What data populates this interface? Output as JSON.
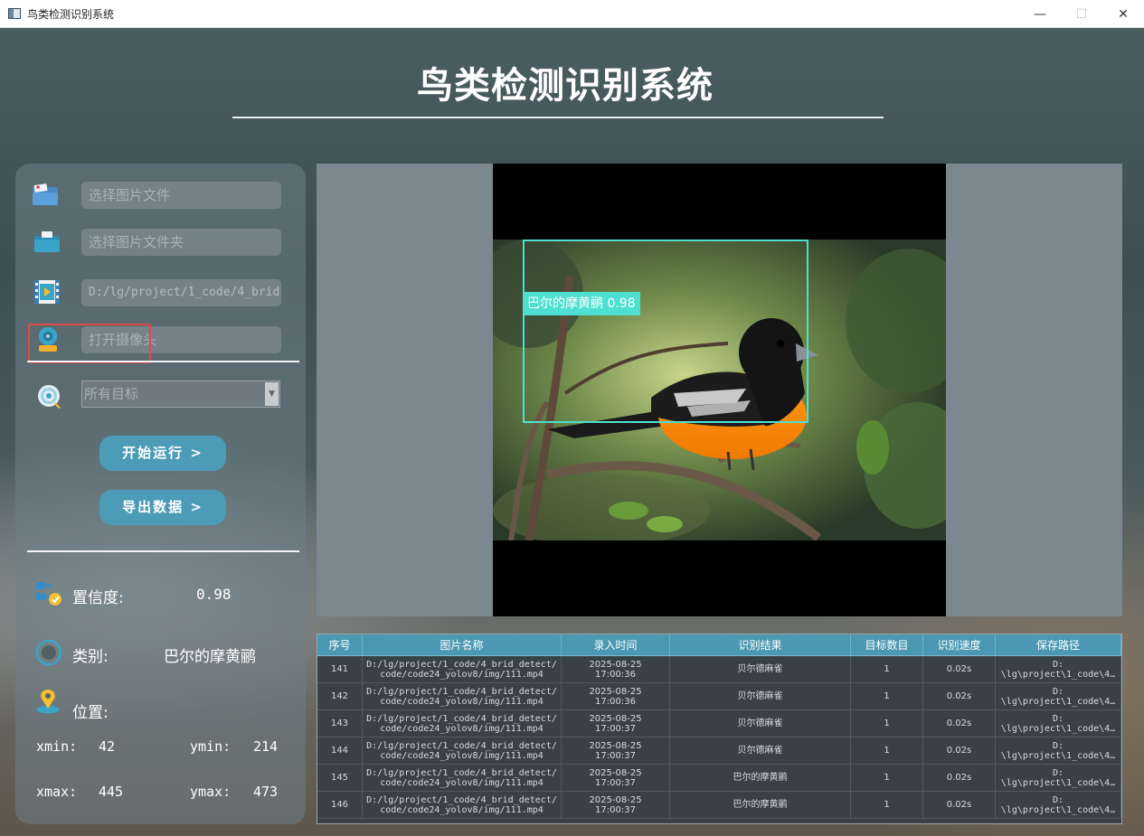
{
  "window": {
    "title": "鸟类检测识别系统",
    "min": "—",
    "max": "☐",
    "close": "✕"
  },
  "header": {
    "title": "鸟类检测识别系统"
  },
  "inputs": {
    "image_file": "选择图片文件",
    "image_folder": "选择图片文件夹",
    "video_path": "D:/lg/project/1_code/4_brid",
    "camera": "打开摄像头"
  },
  "target_select": {
    "value": "所有目标"
  },
  "buttons": {
    "start": "开始运行 >",
    "export": "导出数据 >"
  },
  "info": {
    "confidence_label": "置信度:",
    "confidence_value": "0.98",
    "class_label": "类别:",
    "class_value": "巴尔的摩黄鹂",
    "position_label": "位置:",
    "xmin_label": "xmin:",
    "xmin": "42",
    "ymin_label": "ymin:",
    "ymin": "214",
    "xmax_label": "xmax:",
    "xmax": "445",
    "ymax_label": "ymax:",
    "ymax": "473"
  },
  "detection": {
    "label": "巴尔的摩黄鹂 0.98",
    "box_color": "#4de0d0"
  },
  "table": {
    "headers": [
      "序号",
      "图片名称",
      "录入时间",
      "识别结果",
      "目标数目",
      "识别速度",
      "保存路径"
    ],
    "rows": [
      [
        "141",
        "D:/lg/project/1_code/4_brid_detect/\ncode/code24_yolov8/img/111.mp4",
        "2025-08-25\n17:00:36",
        "贝尔德麻雀",
        "1",
        "0.02s",
        "D:\n\\lg\\project\\1_code\\4…"
      ],
      [
        "142",
        "D:/lg/project/1_code/4_brid_detect/\ncode/code24_yolov8/img/111.mp4",
        "2025-08-25\n17:00:36",
        "贝尔德麻雀",
        "1",
        "0.02s",
        "D:\n\\lg\\project\\1_code\\4…"
      ],
      [
        "143",
        "D:/lg/project/1_code/4_brid_detect/\ncode/code24_yolov8/img/111.mp4",
        "2025-08-25\n17:00:37",
        "贝尔德麻雀",
        "1",
        "0.02s",
        "D:\n\\lg\\project\\1_code\\4…"
      ],
      [
        "144",
        "D:/lg/project/1_code/4_brid_detect/\ncode/code24_yolov8/img/111.mp4",
        "2025-08-25\n17:00:37",
        "贝尔德麻雀",
        "1",
        "0.02s",
        "D:\n\\lg\\project\\1_code\\4…"
      ],
      [
        "145",
        "D:/lg/project/1_code/4_brid_detect/\ncode/code24_yolov8/img/111.mp4",
        "2025-08-25\n17:00:37",
        "巴尔的摩黄鹂",
        "1",
        "0.02s",
        "D:\n\\lg\\project\\1_code\\4…"
      ],
      [
        "146",
        "D:/lg/project/1_code/4_brid_detect/\ncode/code24_yolov8/img/111.mp4",
        "2025-08-25\n17:00:37",
        "巴尔的摩黄鹂",
        "1",
        "0.02s",
        "D:\n\\lg\\project\\1_code\\4…"
      ]
    ]
  },
  "colors": {
    "accent": "#4c9cb8",
    "highlight": "#e04848"
  }
}
